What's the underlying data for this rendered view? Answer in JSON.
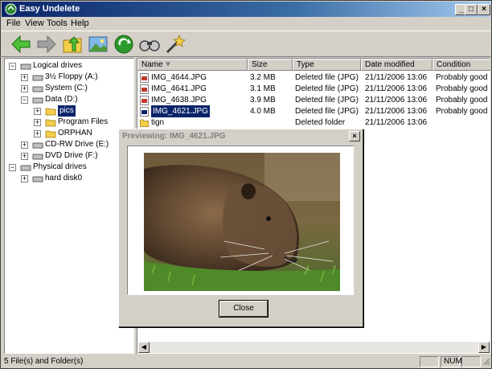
{
  "window": {
    "title": "Easy Undelete"
  },
  "menu": [
    "File",
    "View",
    "Tools",
    "Help"
  ],
  "titlebar_buttons": {
    "minimize": "_",
    "maximize": "□",
    "close": "×"
  },
  "toolbar": [
    "back-icon",
    "forward-icon",
    "up-folder-icon",
    "view-icon",
    "recover-icon",
    "search-icon",
    "wizard-icon"
  ],
  "tree": {
    "logical": "Logical drives",
    "floppy": "3½ Floppy (A:)",
    "system": "System (C:)",
    "data": "Data (D:)",
    "pics": "pics",
    "program_files": "Program Files",
    "orphan": "ORPHAN",
    "cdrw": "CD-RW Drive (E:)",
    "dvd": "DVD Drive (F:)",
    "physical": "Physical drives",
    "disk0": "hard disk0"
  },
  "columns": {
    "name": "Name",
    "size": "Size",
    "type": "Type",
    "modified": "Date modified",
    "condition": "Condition"
  },
  "files": [
    {
      "name": "IMG_4644.JPG",
      "size": "3.2 MB",
      "type": "Deleted file (JPG)",
      "modified": "21/11/2006  13:06",
      "condition": "Probably good"
    },
    {
      "name": "IMG_4641.JPG",
      "size": "3.1 MB",
      "type": "Deleted file (JPG)",
      "modified": "21/11/2006  13:06",
      "condition": "Probably good"
    },
    {
      "name": "IMG_4638.JPG",
      "size": "3.9 MB",
      "type": "Deleted file (JPG)",
      "modified": "21/11/2006  13:06",
      "condition": "Probably good"
    },
    {
      "name": "IMG_4621.JPG",
      "size": "4.0 MB",
      "type": "Deleted file (JPG)",
      "modified": "21/11/2006  13:06",
      "condition": "Probably good"
    },
    {
      "name": "tign",
      "size": "",
      "type": "Deleted folder",
      "modified": "21/11/2006  13:06",
      "condition": ""
    }
  ],
  "dialog": {
    "title": "Previewing: IMG_4621.JPG",
    "close_label": "Close",
    "close_x": "×"
  },
  "status": {
    "text": "5 File(s) and Folder(s)",
    "num": "NUM"
  },
  "colors": {
    "title_bar": "#0a246a",
    "selection": "#0a246a",
    "chrome": "#d4d0c8"
  }
}
